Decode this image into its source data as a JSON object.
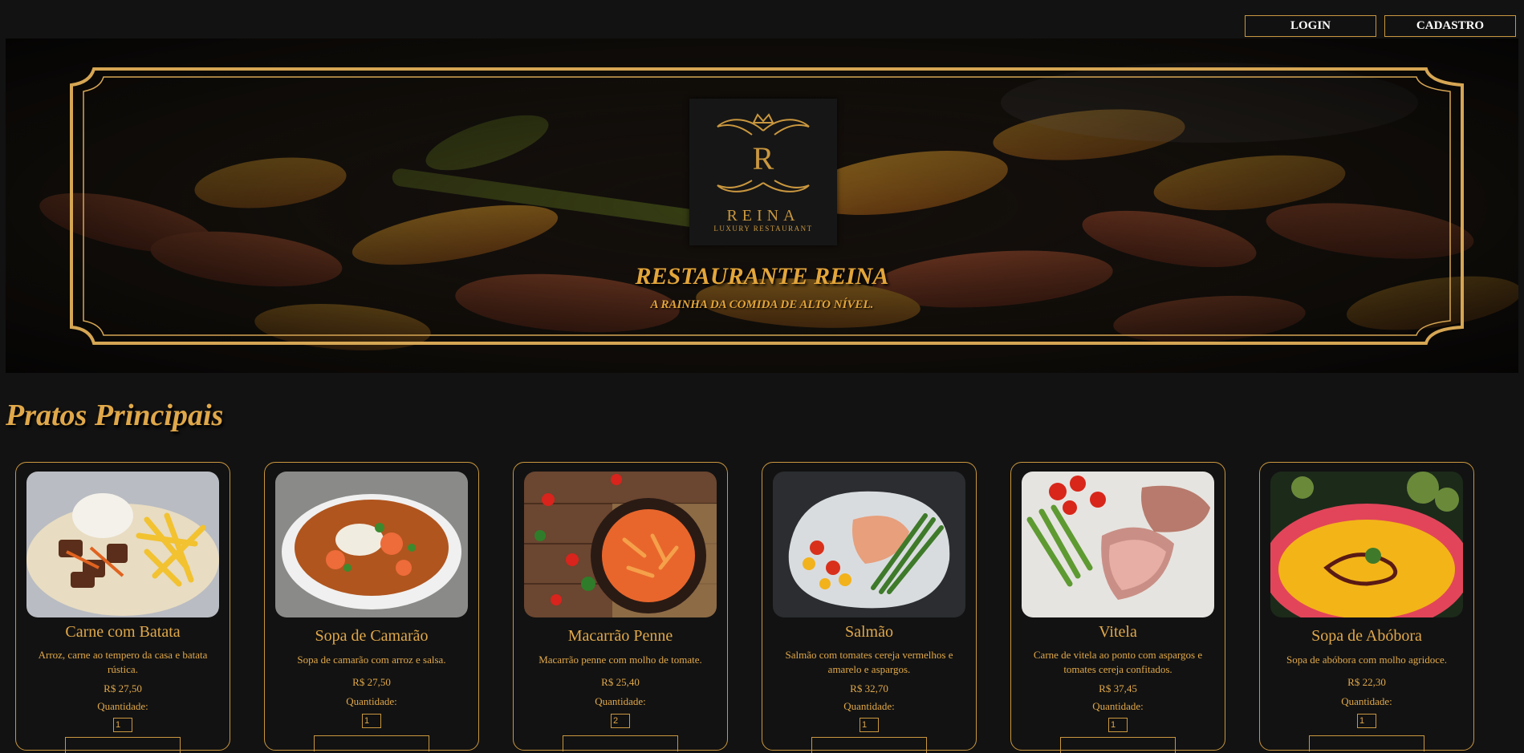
{
  "header": {
    "login_label": "LOGIN",
    "signup_label": "CADASTRO"
  },
  "hero": {
    "logo_letter": "R",
    "logo_name": "REINA",
    "logo_tagline": "LUXURY RESTAURANT",
    "title": "RESTAURANTE REINA",
    "subtitle": "A RAINHA DA COMIDA DE ALTO NÍVEL."
  },
  "section": {
    "title": "Pratos Principais"
  },
  "qty_label": "Quantidade:",
  "dishes": [
    {
      "name": "Carne com Batata",
      "description": "Arroz, carne ao tempero da casa e batata rústica.",
      "price": "R$ 27,50",
      "quantity": "1",
      "image": "beef-and-fries"
    },
    {
      "name": "Sopa de Camarão",
      "description": "Sopa de camarão com arroz e salsa.",
      "price": "R$ 27,50",
      "quantity": "1",
      "image": "shrimp-soup"
    },
    {
      "name": "Macarrão Penne",
      "description": "Macarrão penne com molho de tomate.",
      "price": "R$ 25,40",
      "quantity": "2",
      "image": "penne-pasta"
    },
    {
      "name": "Salmão",
      "description": "Salmão com tomates cereja vermelhos e amarelo e aspargos.",
      "price": "R$ 32,70",
      "quantity": "1",
      "image": "salmon-plate"
    },
    {
      "name": "Vitela",
      "description": "Carne de vitela ao ponto com aspargos e tomates cereja confitados.",
      "price": "R$ 37,45",
      "quantity": "1",
      "image": "veal-plate"
    },
    {
      "name": "Sopa de Abóbora",
      "description": "Sopa de abóbora com molho agridoce.",
      "price": "R$ 22,30",
      "quantity": "1",
      "image": "pumpkin-soup"
    }
  ],
  "colors": {
    "background": "#121212",
    "gold": "#e0a84a",
    "gold_border": "#c9973f"
  }
}
